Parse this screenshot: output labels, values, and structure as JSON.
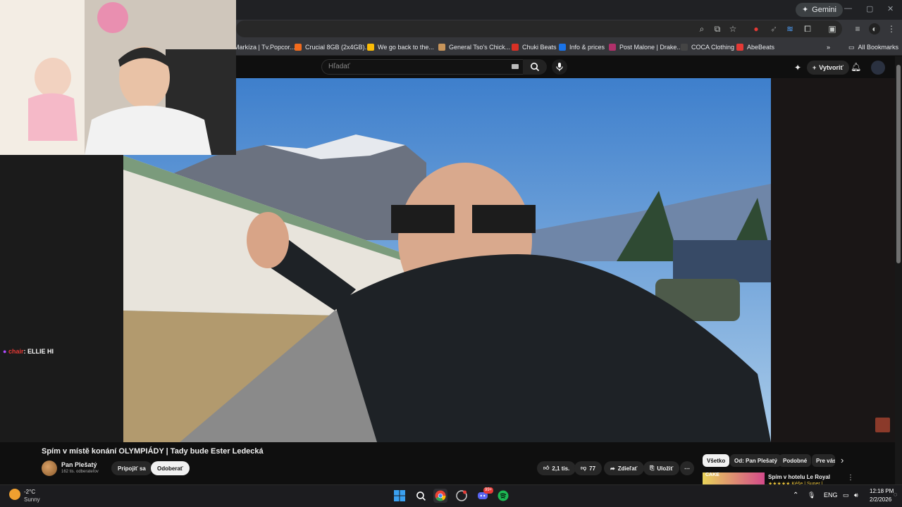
{
  "browser": {
    "gemini_label": "Gemini",
    "win_controls": [
      "—",
      "▢",
      "✕"
    ],
    "bookmarks": [
      {
        "label": "Markíza | Tv.Popcor...",
        "color": "#e8eaed"
      },
      {
        "label": "Crucial 8GB (2x4GB)...",
        "color": "#f26b1d"
      },
      {
        "label": "We go back to the...",
        "color": "#fbbc05"
      },
      {
        "label": "General Tso's Chick...",
        "color": "#c8955a"
      },
      {
        "label": "Chuki Beats",
        "color": "#d93025"
      },
      {
        "label": "Info & prices",
        "color": "#1a73e8"
      },
      {
        "label": "Post Malone | Drake...",
        "color": "#b0306a"
      },
      {
        "label": "COCA Clothing",
        "color": "#444444"
      },
      {
        "label": "AbeBeats",
        "color": "#e53935"
      }
    ],
    "bookmarks_overflow": "»",
    "all_bookmarks": "All Bookmarks"
  },
  "youtube": {
    "search_placeholder": "Hľadať",
    "create_label": "Vytvoriť",
    "video_title": "Spím v místě konání OLYMPIÁDY | Tady bude Ester Ledecká",
    "channel_name": "Pan Plešatý",
    "subscribers": "162 tis. odberateľov",
    "join_label": "Pripojiť sa",
    "subscribe_label": "Odoberať",
    "likes": "2,1 tis.",
    "dislikes": "77",
    "share_label": "Zdieľať",
    "save_label": "Uložiť",
    "more_label": "⋯",
    "chips": [
      "Všetko",
      "Od: Pan Plešatý",
      "Podobné",
      "Pre vás"
    ],
    "chips_next": "›",
    "rec_title": "Spím v hotelu Le Royal",
    "rec_sub": "★★★★★ Kéše | Super |",
    "rec_thumb_text": "CAKE"
  },
  "overlay": {
    "chat_user": "chair",
    "chat_text": ": ELLIE HI"
  },
  "taskbar": {
    "weather_temp": "-2°C",
    "weather_desc": "Sunny",
    "lang": "ENG",
    "time": "12:18 PM",
    "date": "2/2/2026",
    "discord_badge": "99+"
  }
}
